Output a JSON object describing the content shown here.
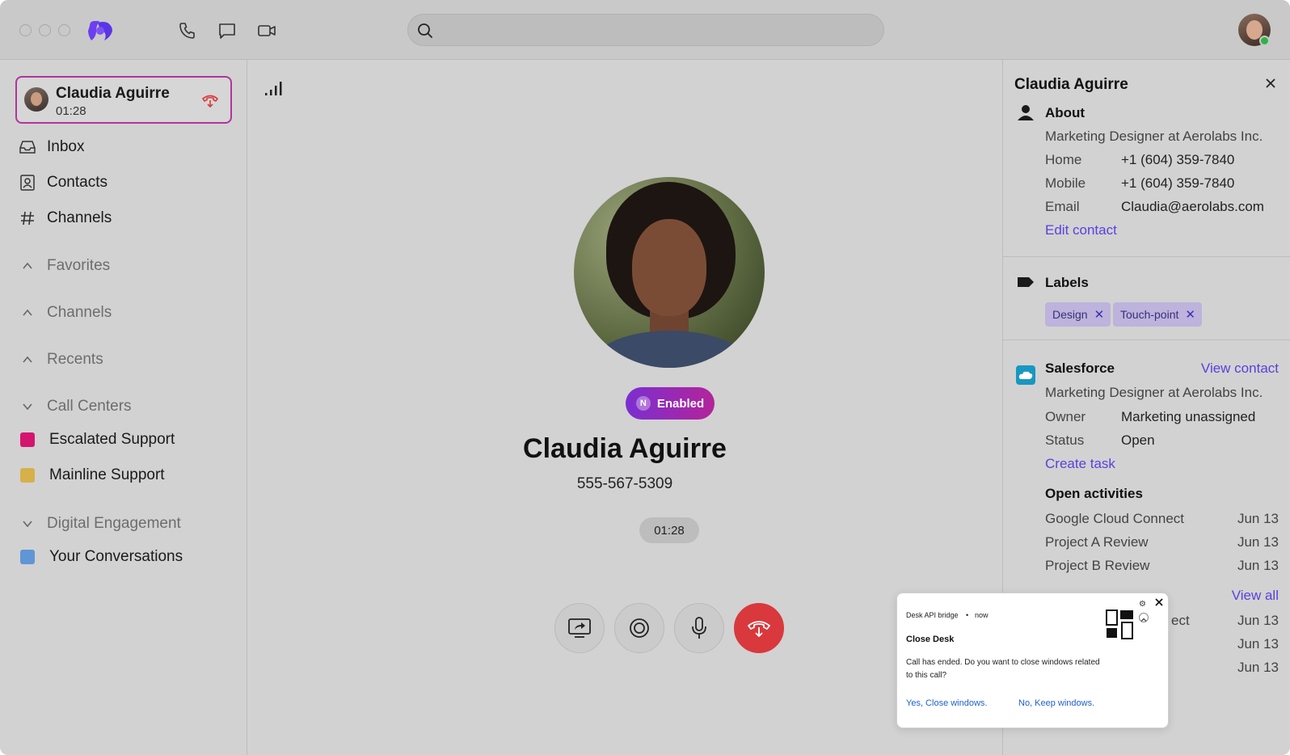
{
  "colors": {
    "accent": "#5b3fe0",
    "end_call": "#d9393c",
    "active_border": "#b0359a",
    "presence": "#2fb344"
  },
  "titlebar": {
    "icons": [
      "phone-icon",
      "chat-icon",
      "video-icon"
    ],
    "search": {
      "placeholder": ""
    }
  },
  "sidebar": {
    "active_call": {
      "name": "Claudia Aguirre",
      "duration": "01:28"
    },
    "nav": [
      {
        "label": "Inbox",
        "icon": "inbox-icon"
      },
      {
        "label": "Contacts",
        "icon": "contacts-icon"
      },
      {
        "label": "Channels",
        "icon": "hash-icon"
      }
    ],
    "sections": {
      "favorites": "Favorites",
      "channels": "Channels",
      "recents": "Recents",
      "call_centers": "Call Centers",
      "digital_engagement": "Digital Engagement"
    },
    "call_centers": [
      {
        "label": "Escalated Support",
        "color": "#d3156f"
      },
      {
        "label": "Mainline Support",
        "color": "#d6b04a"
      }
    ],
    "digital": [
      {
        "label": "Your Conversations",
        "color": "#5f96d6"
      }
    ]
  },
  "main": {
    "badge": "Enabled",
    "badge_letter": "N",
    "caller_name": "Claudia Aguirre",
    "caller_number": "555-567-5309",
    "timer": "01:28",
    "controls": [
      "screen-share-icon",
      "record-icon",
      "microphone-icon",
      "end-call-icon"
    ]
  },
  "panel": {
    "title": "Claudia Aguirre",
    "about": {
      "title": "About",
      "headline": "Marketing Designer at Aerolabs Inc.",
      "fields": [
        {
          "key": "Home",
          "value": "+1 (604) 359-7840"
        },
        {
          "key": "Mobile",
          "value": "+1 (604) 359-7840"
        },
        {
          "key": "Email",
          "value": "Claudia@aerolabs.com"
        }
      ],
      "edit_link": "Edit contact"
    },
    "labels": {
      "title": "Labels",
      "tags": [
        "Design",
        "Touch-point"
      ]
    },
    "salesforce": {
      "title": "Salesforce",
      "view_link": "View contact",
      "headline": "Marketing Designer at Aerolabs Inc.",
      "fields": [
        {
          "key": "Owner",
          "value": "Marketing unassigned"
        },
        {
          "key": "Status",
          "value": "Open"
        }
      ],
      "task_link": "Create task",
      "activities_title": "Open activities",
      "activities": [
        {
          "name": "Google Cloud Connect",
          "date": "Jun 13"
        },
        {
          "name": "Project A Review",
          "date": "Jun 13"
        },
        {
          "name": "Project B Review",
          "date": "Jun 13"
        }
      ],
      "view_all": "View all",
      "hidden_rows": [
        {
          "name_fragment": "ect",
          "date": "Jun 13"
        },
        {
          "name_fragment": "",
          "date": "Jun 13"
        },
        {
          "name_fragment": "",
          "date": "Jun 13"
        }
      ]
    }
  },
  "notification": {
    "app": "Desk API bridge",
    "separator": "•",
    "when": "now",
    "title": "Close Desk",
    "body": "Call has ended. Do you want to close windows related to this call?",
    "action_yes": "Yes, Close windows.",
    "action_no": "No, Keep windows."
  }
}
